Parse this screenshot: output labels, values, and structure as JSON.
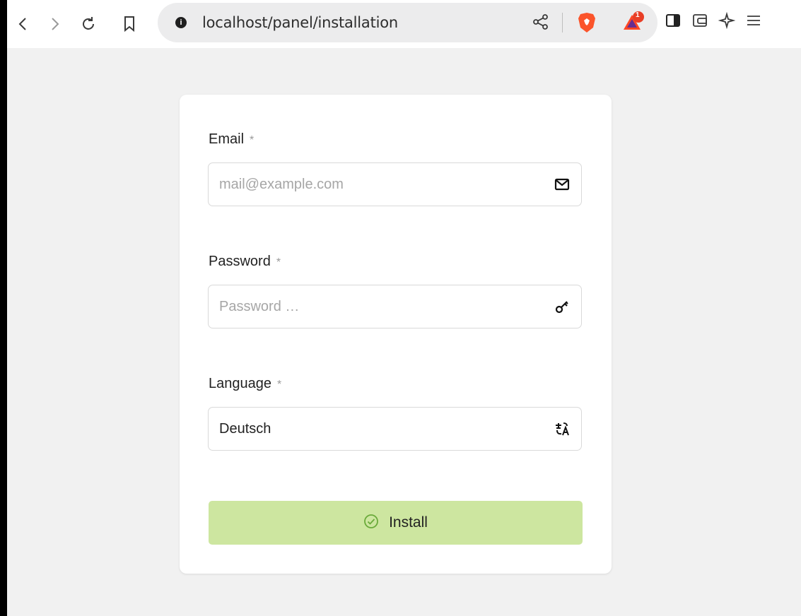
{
  "browser": {
    "url": "localhost/panel/installation",
    "rewards_badge": "1",
    "icons": [
      "back-icon",
      "forward-icon",
      "reload-icon",
      "bookmark-icon",
      "site-info-icon",
      "share-icon",
      "brave-shields-icon",
      "brave-rewards-icon",
      "sidebar-icon",
      "wallet-icon",
      "leo-ai-icon",
      "menu-icon"
    ]
  },
  "form": {
    "email": {
      "label": "Email",
      "required_mark": "*",
      "placeholder": "mail@example.com",
      "value": ""
    },
    "password": {
      "label": "Password",
      "required_mark": "*",
      "placeholder": "Password …",
      "value": ""
    },
    "language": {
      "label": "Language",
      "required_mark": "*",
      "value": "Deutsch"
    },
    "install_label": "Install"
  },
  "colors": {
    "page_bg": "#f1f1f1",
    "card_bg": "#ffffff",
    "install_bg": "#cde6a0",
    "check_icon": "#6aaa3a"
  }
}
